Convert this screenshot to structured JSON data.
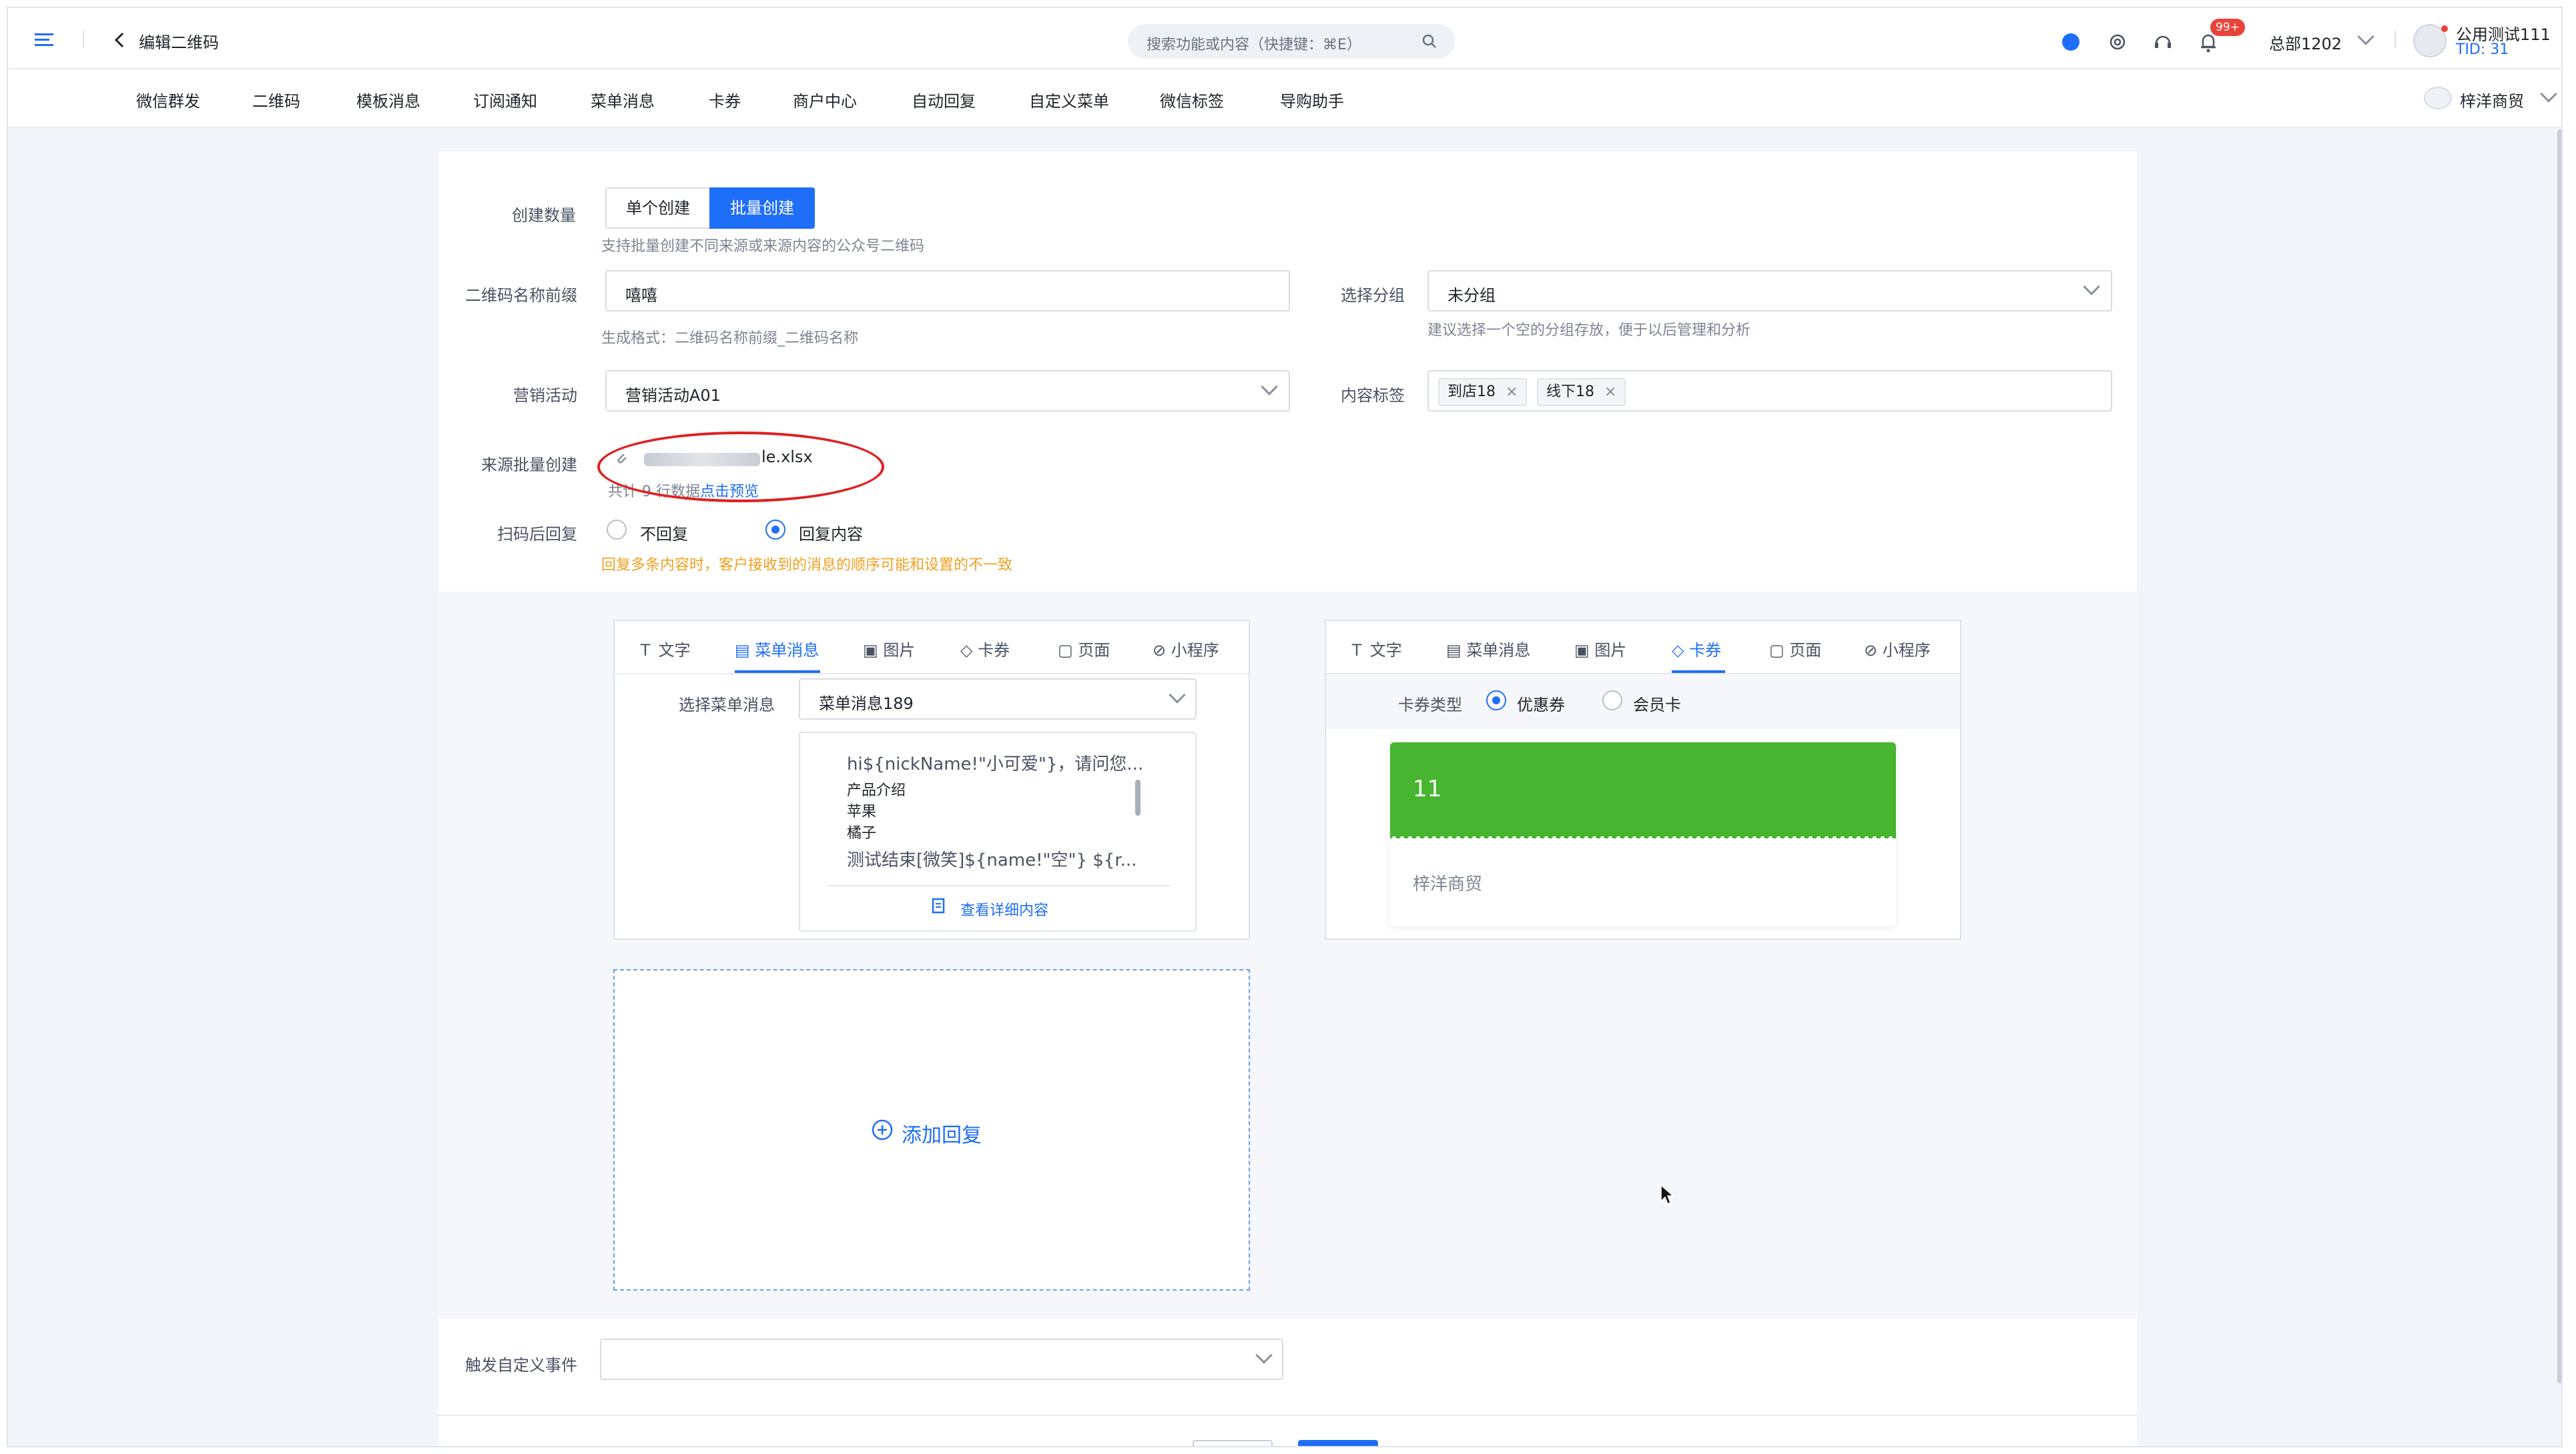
{
  "topbar": {
    "page_title": "编辑二维码",
    "search_placeholder": "搜索功能或内容（快捷键：⌘E）",
    "badge": "99+",
    "org": "总部1202",
    "user_name": "公用测试111",
    "tid": "TID: 31"
  },
  "nav": {
    "items": [
      "微信群发",
      "二维码",
      "模板消息",
      "订阅通知",
      "菜单消息",
      "卡券",
      "商户中心",
      "自动回复",
      "自定义菜单",
      "微信标签",
      "导购助手"
    ],
    "account": "梓洋商贸"
  },
  "form": {
    "create_count_label": "创建数量",
    "single_create": "单个创建",
    "batch_create": "批量创建",
    "batch_hint": "支持批量创建不同来源或来源内容的公众号二维码",
    "prefix_label": "二维码名称前缀",
    "prefix_value": "嘻嘻",
    "prefix_hint": "生成格式：二维码名称前缀_二维码名称",
    "group_label": "选择分组",
    "group_value": "未分组",
    "group_hint": "建议选择一个空的分组存放，便于以后管理和分析",
    "campaign_label": "营销活动",
    "campaign_value": "营销活动A01",
    "content_tag_label": "内容标签",
    "tags": [
      "到店18",
      "线下18"
    ],
    "source_label": "来源批量创建",
    "file_name": "le.xlsx",
    "rows_info": "共计 9 行数据",
    "preview_link": "点击预览",
    "reply_label": "扫码后回复",
    "no_reply": "不回复",
    "reply_content": "回复内容",
    "reply_warning": "回复多条内容时，客户接收到的消息的顺序可能和设置的不一致",
    "trigger_label": "触发自定义事件"
  },
  "reply_tabs": [
    "文字",
    "菜单消息",
    "图片",
    "卡券",
    "页面",
    "小程序"
  ],
  "panel_left": {
    "select_label": "选择菜单消息",
    "select_value": "菜单消息189",
    "preview_line1": "hi${nickName!\"小可爱\"}，请问您...",
    "menu_items": [
      "产品介绍",
      "苹果",
      "橘子"
    ],
    "preview_line_last": "测试结束[微笑]${name!\"空\"} ${r...",
    "detail_link": "查看详细内容"
  },
  "panel_right": {
    "card_type_label": "卡券类型",
    "coupon": "优惠券",
    "member_card": "会员卡",
    "card_title": "11",
    "merchant": "梓洋商贸"
  },
  "add_reply": "添加回复",
  "colors": {
    "primary": "#1f6ef7",
    "coupon_green": "#47b52f",
    "warning": "#f0a020",
    "annotation_red": "#e02020"
  }
}
